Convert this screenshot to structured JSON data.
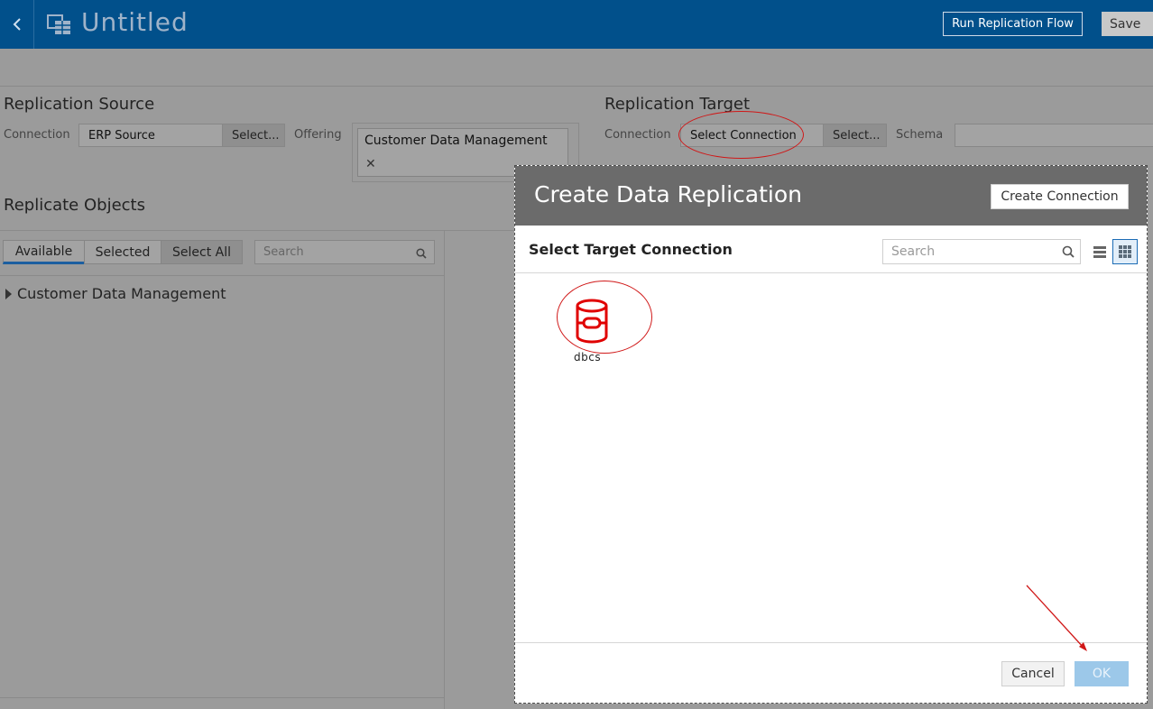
{
  "header": {
    "title": "Untitled",
    "run_label": "Run Replication Flow",
    "save_label": "Save"
  },
  "source": {
    "title": "Replication Source",
    "connection_label": "Connection",
    "connection_value": "ERP Source",
    "select_label": "Select...",
    "offering_label": "Offering",
    "offering_value": "Customer Data Management",
    "offering_remove": "✕"
  },
  "target": {
    "title": "Replication Target",
    "connection_label": "Connection",
    "connection_value": "Select Connection",
    "select_label": "Select...",
    "schema_label": "Schema"
  },
  "replicate": {
    "title": "Replicate Objects",
    "tabs": [
      "Available",
      "Selected",
      "Select All"
    ],
    "search_placeholder": "Search",
    "tree_item": "Customer Data Management"
  },
  "dialog": {
    "title": "Create Data Replication",
    "create_connection_label": "Create Connection",
    "subtitle": "Select Target Connection",
    "search_placeholder": "Search",
    "tiles": [
      {
        "label": "dbcs",
        "icon": "database-icon"
      }
    ],
    "cancel_label": "Cancel",
    "ok_label": "OK"
  },
  "colors": {
    "header_bg": "#01508b",
    "dialog_header_bg": "#6b6b6b",
    "annotation": "#d01818",
    "ok_disabled": "#9cc8e9"
  }
}
